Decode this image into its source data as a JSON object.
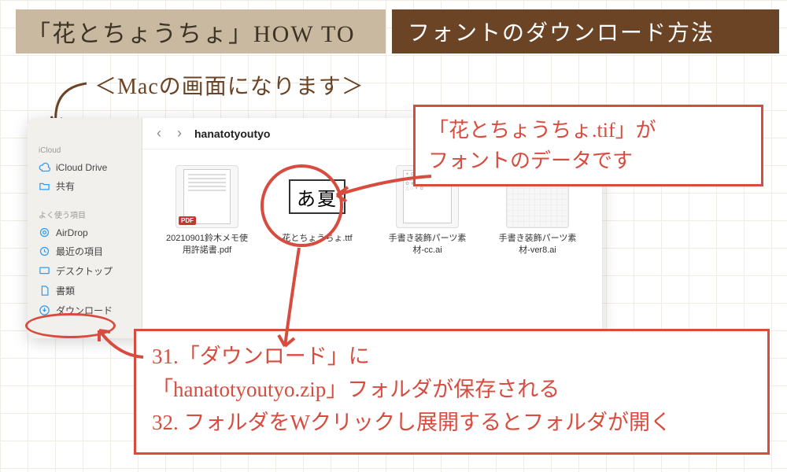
{
  "header": {
    "left_banner": "「花とちょうちょ」HOW TO",
    "right_banner": "フォントのダウンロード方法"
  },
  "mac_note": "＜Macの画面になります＞",
  "finder": {
    "folder_title": "hanatotyoutyo",
    "sidebar": {
      "sections": [
        {
          "label": "iCloud",
          "items": [
            "iCloud Drive",
            "共有"
          ]
        },
        {
          "label": "よく使う項目",
          "items": [
            "AirDrop",
            "最近の項目",
            "デスクトップ",
            "書類",
            "ダウンロード"
          ]
        }
      ]
    },
    "files": [
      {
        "name": "20210901鈴木メモ使用許諾書.pdf",
        "type": "pdf"
      },
      {
        "name": "花とちょうちょ.ttf",
        "type": "ttf",
        "preview": "あ夏"
      },
      {
        "name": "手書き装飾パーツ素材-cc.ai",
        "type": "ai"
      },
      {
        "name": "手書き装飾パーツ素材-ver8.ai",
        "type": "ai"
      }
    ]
  },
  "callouts": {
    "top_line1": "「花とちょうちょ.tif」が",
    "top_line2": "フォントのデータです",
    "bottom_line1": "31.「ダウンロード」に",
    "bottom_line2": "「hanatotyoutyo.zip」フォルダが保存される",
    "bottom_line3": "32. フォルダをWクリックし展開するとフォルダが開く"
  },
  "colors": {
    "accent_red": "#d84b3f",
    "banner_beige": "#c8b9a0",
    "banner_brown": "#6b4426"
  }
}
